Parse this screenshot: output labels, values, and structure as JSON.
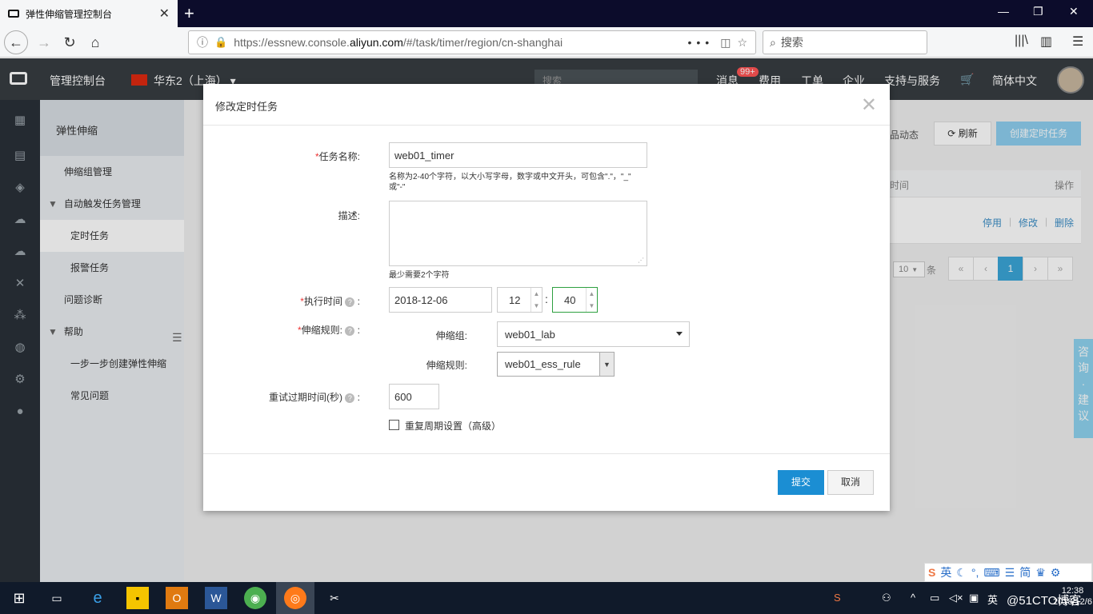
{
  "browser": {
    "tab_title": "弹性伸缩管理控制台",
    "url_prefix": "https://essnew.console.",
    "url_domain": "aliyun.com",
    "url_suffix": "/#/task/timer/region/cn-shanghai",
    "search_placeholder": "搜索"
  },
  "console": {
    "home": "管理控制台",
    "region": "华东2（上海）",
    "search_placeholder": "搜索",
    "messages": "消息",
    "messages_badge": "99+",
    "billing": "费用",
    "tickets": "工单",
    "enterprise": "企业",
    "support": "支持与服务",
    "language": "简体中文"
  },
  "sidemenu": {
    "title": "弹性伸缩",
    "items": [
      {
        "label": "伸缩组管理"
      },
      {
        "label": "自动触发任务管理"
      },
      {
        "label": "定时任务"
      },
      {
        "label": "报警任务"
      },
      {
        "label": "问题诊断"
      },
      {
        "label": "帮助"
      },
      {
        "label": "一步一步创建弹性伸缩"
      },
      {
        "label": "常见问题"
      }
    ]
  },
  "main": {
    "product_news": "品动态",
    "refresh": "刷新",
    "create_task": "创建定时任务",
    "col_time": "时间",
    "col_ops": "操作",
    "op_disable": "停用",
    "op_edit": "修改",
    "op_delete": "删除",
    "page_size": "10",
    "page_size_unit": "条",
    "pages": [
      "«",
      "‹",
      "1",
      "›",
      "»"
    ],
    "consult": [
      "咨",
      "询",
      "·",
      "建",
      "议"
    ]
  },
  "dialog": {
    "title": "修改定时任务",
    "name_label": "任务名称:",
    "name_value": "web01_timer",
    "name_hint_1": "名称为2-40个字符，以大小写字母，数字或中文开头，可包含\".\"，\"_\"",
    "name_hint_2": "或\"-\"",
    "desc_label": "描述:",
    "desc_hint": "最少需要2个字符",
    "time_label": "执行时间",
    "date_value": "2018-12-06",
    "hour_value": "12",
    "minute_value": "40",
    "time_colon": ":",
    "rule_label": "伸缩规则:",
    "group_sublabel": "伸缩组:",
    "group_value": "web01_lab",
    "rule_sublabel": "伸缩规则:",
    "rule_value": "web01_ess_rule",
    "retry_label": "重试过期时间(秒)",
    "retry_value": "600",
    "repeat_label": "重复周期设置（高级）",
    "submit": "提交",
    "cancel": "取消"
  },
  "ime": {
    "mode": "英",
    "simplified": "简"
  },
  "taskbar": {
    "lang": "英",
    "time": "12:38",
    "date": "2018/12/6",
    "watermark": "@51CTO博客"
  }
}
